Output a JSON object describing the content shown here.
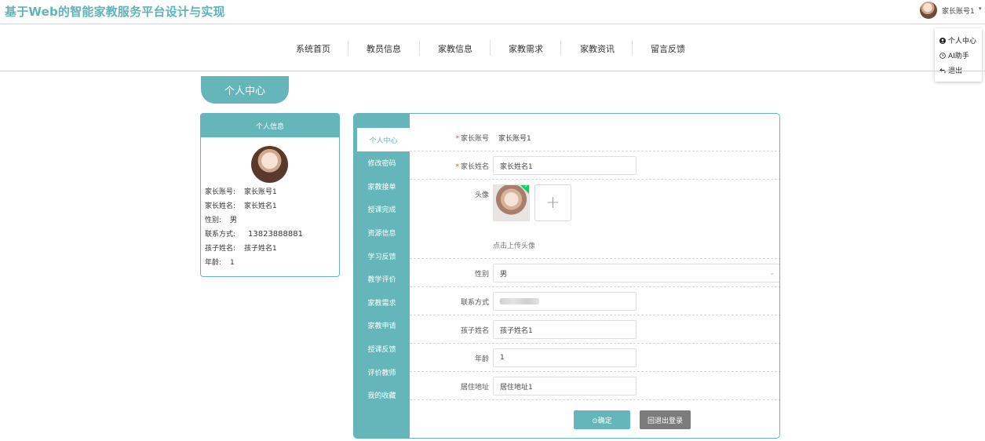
{
  "header": {
    "site_title": "基于Web的智能家教服务平台设计与实现",
    "user_name": "家长账号1",
    "caret": "▾",
    "dropdown": [
      {
        "icon": "user-icon",
        "label": "个人中心"
      },
      {
        "icon": "clock-icon",
        "label": "AI助手"
      },
      {
        "icon": "logout-icon",
        "label": "退出"
      }
    ]
  },
  "nav": [
    "系统首页",
    "教员信息",
    "家教信息",
    "家教需求",
    "家教资讯",
    "留言反馈"
  ],
  "section_tab": "个人中心",
  "info_card": {
    "title": "个人信息",
    "rows": [
      {
        "k": "家长账号:",
        "v": "家长账号1"
      },
      {
        "k": "家长姓名:",
        "v": "家长姓名1"
      },
      {
        "k": "性别:",
        "v": "男"
      },
      {
        "k": "联系方式:",
        "v": "13823888881"
      },
      {
        "k": "孩子姓名:",
        "v": "孩子姓名1"
      },
      {
        "k": "年龄:",
        "v": "1"
      }
    ]
  },
  "side_menu": [
    "个人中心",
    "修改密码",
    "家教接单",
    "授课完成",
    "资源信息",
    "学习反馈",
    "教学评价",
    "家教需求",
    "家教申请",
    "授课反馈",
    "评价教师",
    "我的收藏"
  ],
  "form": {
    "account_label": "家长账号",
    "account_value": "家长账号1",
    "name_label": "家长姓名",
    "name_value": "家长姓名1",
    "avatar_label": "头像",
    "avatar_hint": "点击上传头像",
    "upload_plus": "+",
    "gender_label": "性别",
    "gender_value": "男",
    "contact_label": "联系方式",
    "child_label": "孩子姓名",
    "child_value": "孩子姓名1",
    "age_label": "年龄",
    "age_value": "1",
    "address_label": "居住地址",
    "address_value": "居住地址1",
    "required_mark": "*",
    "select_arrow": "⌄"
  },
  "buttons": {
    "confirm": "⊙确定",
    "logout": "回退出登录"
  },
  "colors": {
    "accent": "#64b6ba",
    "title": "#5fb4b7",
    "logout_button": "#7b7b7b"
  }
}
